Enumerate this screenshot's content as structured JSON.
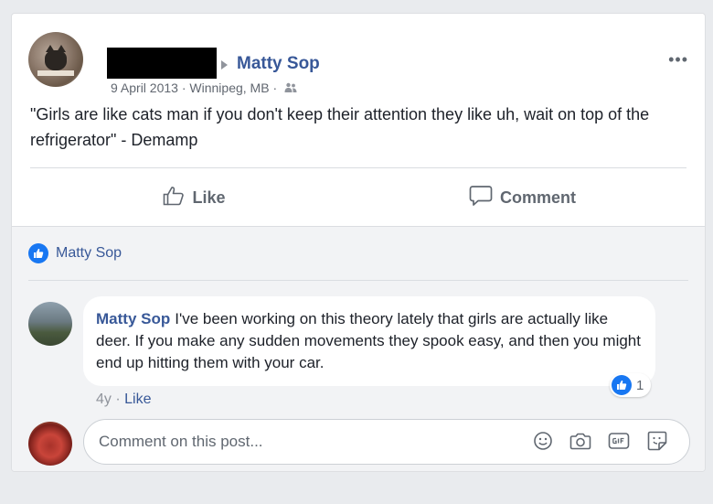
{
  "post": {
    "target_name": "Matty Sop",
    "date": "9 April 2013",
    "location": "Winnipeg, MB",
    "meta_sep": "·",
    "more_label": "•••",
    "text": "\"Girls are like cats man if you don't keep their attention they like uh, wait on top of the refrigerator\" - Demamp"
  },
  "actions": {
    "like_label": "Like",
    "comment_label": "Comment"
  },
  "reactions": {
    "names": "Matty Sop"
  },
  "comment": {
    "author": "Matty Sop",
    "text": "I've been working on this theory lately that girls are actually like deer. If you make any sudden movements they spook easy, and then you might end up hitting them with your car.",
    "reaction_count": "1",
    "age": "4y",
    "sep": "·",
    "like_label": "Like"
  },
  "composer": {
    "placeholder": "Comment on this post..."
  },
  "colors": {
    "link_blue": "#385898",
    "like_blue": "#1877f2",
    "page_bg": "#e9ebee",
    "footer_bg": "#f2f3f5"
  },
  "icons": [
    "arrow-right-icon",
    "friends-icon",
    "more-icon",
    "thumbs-up-icon",
    "comment-icon",
    "like-reaction-icon",
    "emoji-icon",
    "camera-icon",
    "gif-icon",
    "sticker-icon"
  ]
}
